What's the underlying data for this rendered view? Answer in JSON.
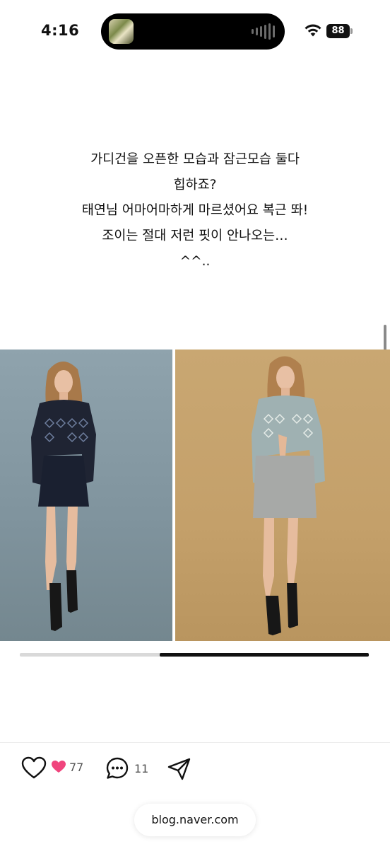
{
  "status_bar": {
    "time": "4:16",
    "battery": "88",
    "icons": [
      "now-playing-artwork",
      "audio-waveform-icon",
      "wifi-icon",
      "battery-icon"
    ]
  },
  "post": {
    "caption_lines": [
      "가디건을 오픈한 모습과 잠근모습 둘다",
      "힙하죠?",
      "태연님 어마어마하게 마르셨어요 복근 똬!",
      "조이는 절대 저런 핏이 안나오는…",
      "^^.."
    ],
    "images": [
      {
        "description": "model-navy-cardigan-skirt",
        "background": "#8a9ea8"
      },
      {
        "description": "model-grey-cardigan-skirt",
        "background": "#c6a36d"
      }
    ],
    "carousel_progress": 0.6
  },
  "actions": {
    "like_count": "77",
    "comment_count": "11",
    "icons": [
      "heart-outline-icon",
      "heart-filled-icon",
      "comment-icon",
      "share-icon"
    ],
    "accent_color": "#f0457d"
  },
  "browser": {
    "url": "blog.naver.com"
  }
}
